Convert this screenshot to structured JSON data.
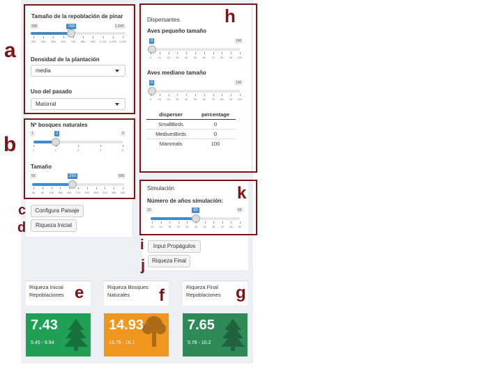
{
  "panel_a": {
    "repop_label": "Tamaño de la repoblación de pinar",
    "repop_min": "200",
    "repop_max": "1,500",
    "repop_value": "750",
    "repop_ticks": [
      "200",
      "330",
      "460",
      "590",
      "720",
      "850",
      "980",
      "1,110",
      "1,240",
      "1,500"
    ],
    "repop_fraction": 0.423,
    "density_label": "Densidad de la plantación",
    "density_value": "media",
    "past_use_label": "Uso del pasado",
    "past_use_value": "Matorral"
  },
  "panel_b": {
    "bosques_label": "Nº bosques naturales",
    "bosques_min": "1",
    "bosques_max": "5",
    "bosques_value": "2",
    "bosques_ticks": [
      "1",
      "2",
      "3",
      "4",
      "5"
    ],
    "bosques_fraction": 0.25,
    "tamano_label": "Tamaño",
    "tamano_min": "50",
    "tamano_max": "500",
    "tamano_value": "250",
    "tamano_ticks": [
      "50",
      "95",
      "140",
      "185",
      "230",
      "275",
      "320",
      "365",
      "410",
      "455",
      "500"
    ],
    "tamano_fraction": 0.444
  },
  "buttons": {
    "configura": "Configura Paisaje",
    "riqueza_inicial": "Riqueza Inicial",
    "input_propagulos": "Input Propágulos",
    "riqueza_final": "Riqueza Final"
  },
  "panel_h": {
    "title": "Dispersantes",
    "small_label": "Aves pequeño tamaño",
    "small_min": "0",
    "small_max": "100",
    "small_value": "0",
    "medium_label": "Aves mediano tamaño",
    "medium_min": "0",
    "medium_max": "100",
    "medium_value": "0",
    "ticks": [
      "0",
      "10",
      "20",
      "30",
      "40",
      "50",
      "60",
      "70",
      "80",
      "90",
      "100"
    ],
    "small_fraction": 0,
    "medium_fraction": 0,
    "table_headers": [
      "disperser",
      "percentage"
    ],
    "table_rows": [
      [
        "SmallBirds",
        "0"
      ],
      [
        "MediumBirds",
        "0"
      ],
      [
        "Mammals",
        "100"
      ]
    ]
  },
  "panel_k": {
    "title": "Simulación",
    "years_label": "Número de años simulación:",
    "years_min": "10",
    "years_max": "50",
    "years_value": "30",
    "years_ticks": [
      "10",
      "14",
      "18",
      "22",
      "26",
      "30",
      "34",
      "38",
      "42",
      "46",
      "50"
    ],
    "years_fraction": 0.5
  },
  "value_boxes": {
    "e_title": "Riqueza Inicial Repoblaciones",
    "e_value": "7.43",
    "e_range": "5.45 - 9.94",
    "e_color": "#1fa055",
    "f_title": "Riqueza Bosques Naturales",
    "f_value": "14.93",
    "f_range": "13.75 - 16.1",
    "f_color": "#f0961e",
    "g_title": "Riqueza Final Repoblaciones",
    "g_value": "7.65",
    "g_range": "5.78 - 10.2",
    "g_color": "#2e8b57"
  },
  "annotations": {
    "a": "a",
    "b": "b",
    "c": "c",
    "d": "d",
    "e": "e",
    "f": "f",
    "g": "g",
    "h": "h",
    "i": "i",
    "j": "j",
    "k": "k"
  }
}
